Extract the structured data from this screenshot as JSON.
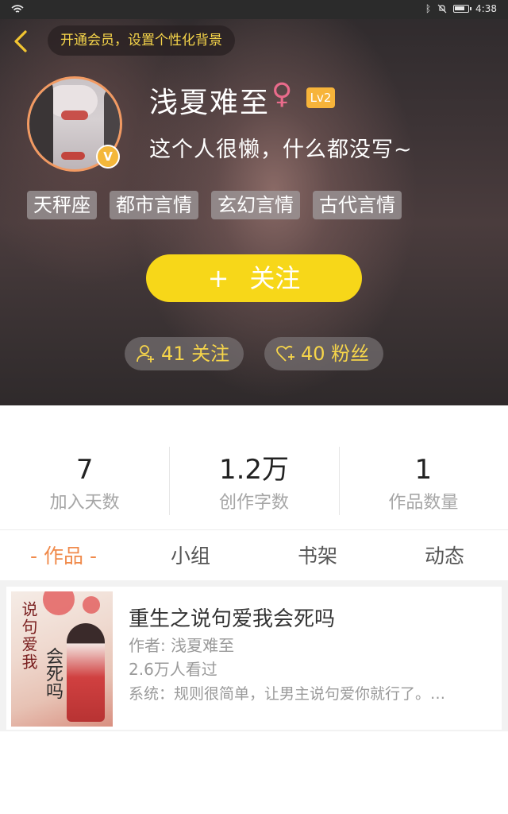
{
  "status_bar": {
    "time": "4:38"
  },
  "header": {
    "vip_banner": "开通会员，设置个性化背景",
    "username": "浅夏难至",
    "gender_symbol": "♀",
    "level": "Lv2",
    "verified_badge": "V",
    "bio": "这个人很懒，什么都没写~",
    "tags": [
      "天秤座",
      "都市言情",
      "玄幻言情",
      "古代言情"
    ],
    "follow_button": {
      "plus": "+",
      "label": "关注"
    },
    "following_label": "41 关注",
    "fans_label": "40 粉丝"
  },
  "stats": [
    {
      "value": "7",
      "label": "加入天数"
    },
    {
      "value": "1.2万",
      "label": "创作字数"
    },
    {
      "value": "1",
      "label": "作品数量"
    }
  ],
  "tabs": [
    "- 作品 -",
    "小组",
    "书架",
    "动态"
  ],
  "works": [
    {
      "cover_title": "说句爱我",
      "cover_subtitle": "会死吗",
      "title": "重生之说句爱我会死吗",
      "author": "作者: 浅夏难至",
      "views": "2.6万人看过",
      "description": "系统：规则很简单，让男主说句爱你就行了。…"
    }
  ],
  "colors": {
    "accent_yellow": "#f7d719",
    "active_tab": "#f08a4b",
    "banner_text": "#f6d54a"
  }
}
